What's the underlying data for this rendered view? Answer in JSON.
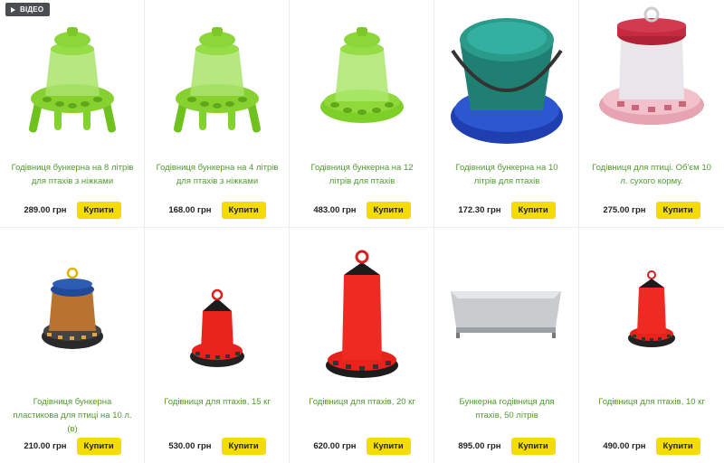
{
  "badge": {
    "label": "ВІДЕО"
  },
  "products": [
    {
      "title": "Годівниця бункерна на 8 літрів для птахів з ніжками",
      "price": "289.00 грн",
      "buy_label": "Купити",
      "image": "green-feeder-legs-icon"
    },
    {
      "title": "Годівниця бункерна на 4 літрів для птахів з ніжками",
      "price": "168.00 грн",
      "buy_label": "Купити",
      "image": "green-feeder-legs-icon"
    },
    {
      "title": "Годівниця бункерна на 12 літрів для птахів",
      "price": "483.00 грн",
      "buy_label": "Купити",
      "image": "green-feeder-icon"
    },
    {
      "title": "Годівниця бункерна на 10 літрів для птахів",
      "price": "172.30 грн",
      "buy_label": "Купити",
      "image": "bucket-feeder-icon"
    },
    {
      "title": "Годівниця для птиці. Об'єм 10 л. сухого корму.",
      "price": "275.00 грн",
      "buy_label": "Купити",
      "image": "pink-feeder-icon"
    },
    {
      "title": "Годівниця бункерна пластикова для птиці на 10 л. (в)",
      "price": "210.00 грн",
      "buy_label": "Купити",
      "image": "brown-feeder-icon"
    },
    {
      "title": "Годівниця для птахів, 15 кг",
      "price": "530.00 грн",
      "buy_label": "Купити",
      "image": "red-feeder-icon"
    },
    {
      "title": "Годівниця для птахів, 20 кг",
      "price": "620.00 грн",
      "buy_label": "Купити",
      "image": "red-tall-feeder-icon"
    },
    {
      "title": "Бункерна годівниця для птахів, 50 літрів",
      "price": "895.00 грн",
      "buy_label": "Купити",
      "image": "trough-feeder-icon"
    },
    {
      "title": "Годівниця для птахів, 10 кг",
      "price": "490.00 грн",
      "buy_label": "Купити",
      "image": "red-small-feeder-icon"
    }
  ]
}
